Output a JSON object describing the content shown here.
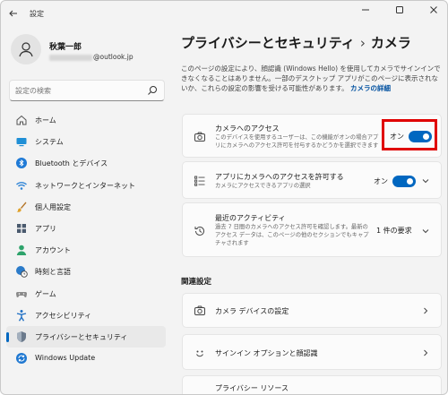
{
  "window": {
    "title": "設定"
  },
  "user": {
    "name": "秋葉一郎",
    "email_suffix": "@outlook.jp"
  },
  "search": {
    "placeholder": "設定の検索"
  },
  "sidebar": {
    "items": [
      {
        "label": "ホーム",
        "icon": "home-icon"
      },
      {
        "label": "システム",
        "icon": "system-icon"
      },
      {
        "label": "Bluetooth とデバイス",
        "icon": "bluetooth-icon"
      },
      {
        "label": "ネットワークとインターネット",
        "icon": "wifi-icon"
      },
      {
        "label": "個人用設定",
        "icon": "brush-icon"
      },
      {
        "label": "アプリ",
        "icon": "apps-icon"
      },
      {
        "label": "アカウント",
        "icon": "account-icon"
      },
      {
        "label": "時刻と言語",
        "icon": "globe-clock-icon"
      },
      {
        "label": "ゲーム",
        "icon": "gamepad-icon"
      },
      {
        "label": "アクセシビリティ",
        "icon": "accessibility-icon"
      },
      {
        "label": "プライバシーとセキュリティ",
        "icon": "shield-icon",
        "active": true
      },
      {
        "label": "Windows Update",
        "icon": "update-icon"
      }
    ]
  },
  "header": {
    "parent": "プライバシーとセキュリティ",
    "separator": "›",
    "current": "カメラ"
  },
  "description": {
    "text": "このページの設定により、顔認識 (Windows Hello) を使用してカメラでサインインできなくなることはありません。一部のデスクトップ アプリがこのページに表示されないか、これらの設定の影響を受ける可能性があります。",
    "link": "カメラの詳細"
  },
  "cards": {
    "camera_access": {
      "title": "カメラへのアクセス",
      "subtitle": "このデバイスを使用するユーザーは、この機能がオンの場合アプリにカメラへのアクセス許可を付与するかどうかを選択できます",
      "state": "オン",
      "on": true
    },
    "app_access": {
      "title": "アプリにカメラへのアクセスを許可する",
      "subtitle": "カメラにアクセスできるアプリの選択",
      "state": "オン",
      "on": true
    },
    "recent_activity": {
      "title": "最近のアクティビティ",
      "subtitle": "過去 7 日間のカメラへのアクセス許可を確認します。最新のアクセス データは、このページの他のセクションでもキャプチャされます",
      "value": "1 件の要求"
    }
  },
  "related": {
    "title": "関連設定",
    "items": [
      {
        "label": "カメラ デバイスの設定",
        "icon": "camera-icon"
      },
      {
        "label": "サインイン オプションと顔認識",
        "icon": "face-icon"
      },
      {
        "label": "プライバシー リソース",
        "icon": ""
      }
    ]
  },
  "colors": {
    "accent": "#0067c0",
    "highlight": "#e00000"
  }
}
